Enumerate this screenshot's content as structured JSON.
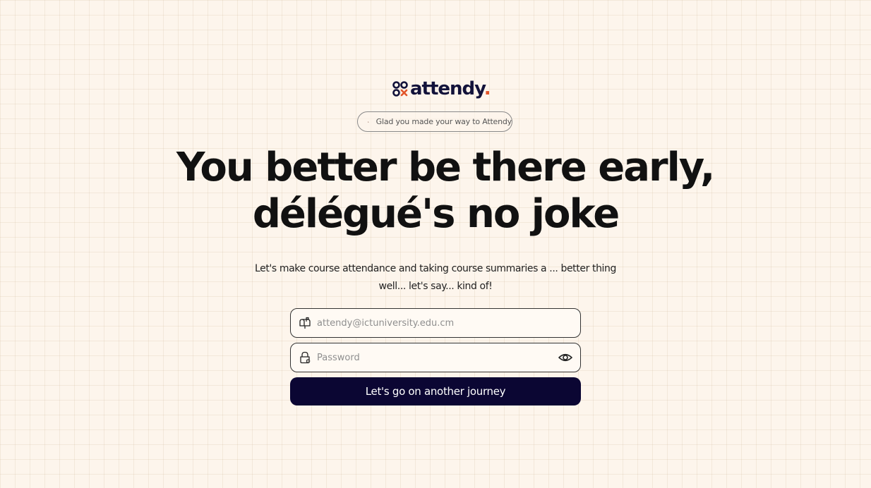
{
  "brand": {
    "name": "attendy",
    "dot": "."
  },
  "welcome_pill": {
    "text": "Glad you made your way to Attendy",
    "icon": "peace-hand-icon"
  },
  "headline": {
    "line1": "You better be there early,",
    "line2": "délégué's no joke"
  },
  "subtitle": {
    "line1": "Let's make course attendance and taking course summaries a ... better thing",
    "line2": "well... let's say... kind of!"
  },
  "form": {
    "email": {
      "placeholder": "attendy@ictuniversity.edu.cm",
      "value": "",
      "icon": "mailbox-icon"
    },
    "password": {
      "placeholder": "Password",
      "value": "",
      "icon": "lock-icon",
      "toggle_icon": "eye-icon"
    },
    "submit_label": "Let's go on another journey"
  },
  "colors": {
    "background": "#fdf5ec",
    "brand_navy": "#12123a",
    "brand_orange": "#e2552a",
    "button_bg": "#0b0633"
  }
}
